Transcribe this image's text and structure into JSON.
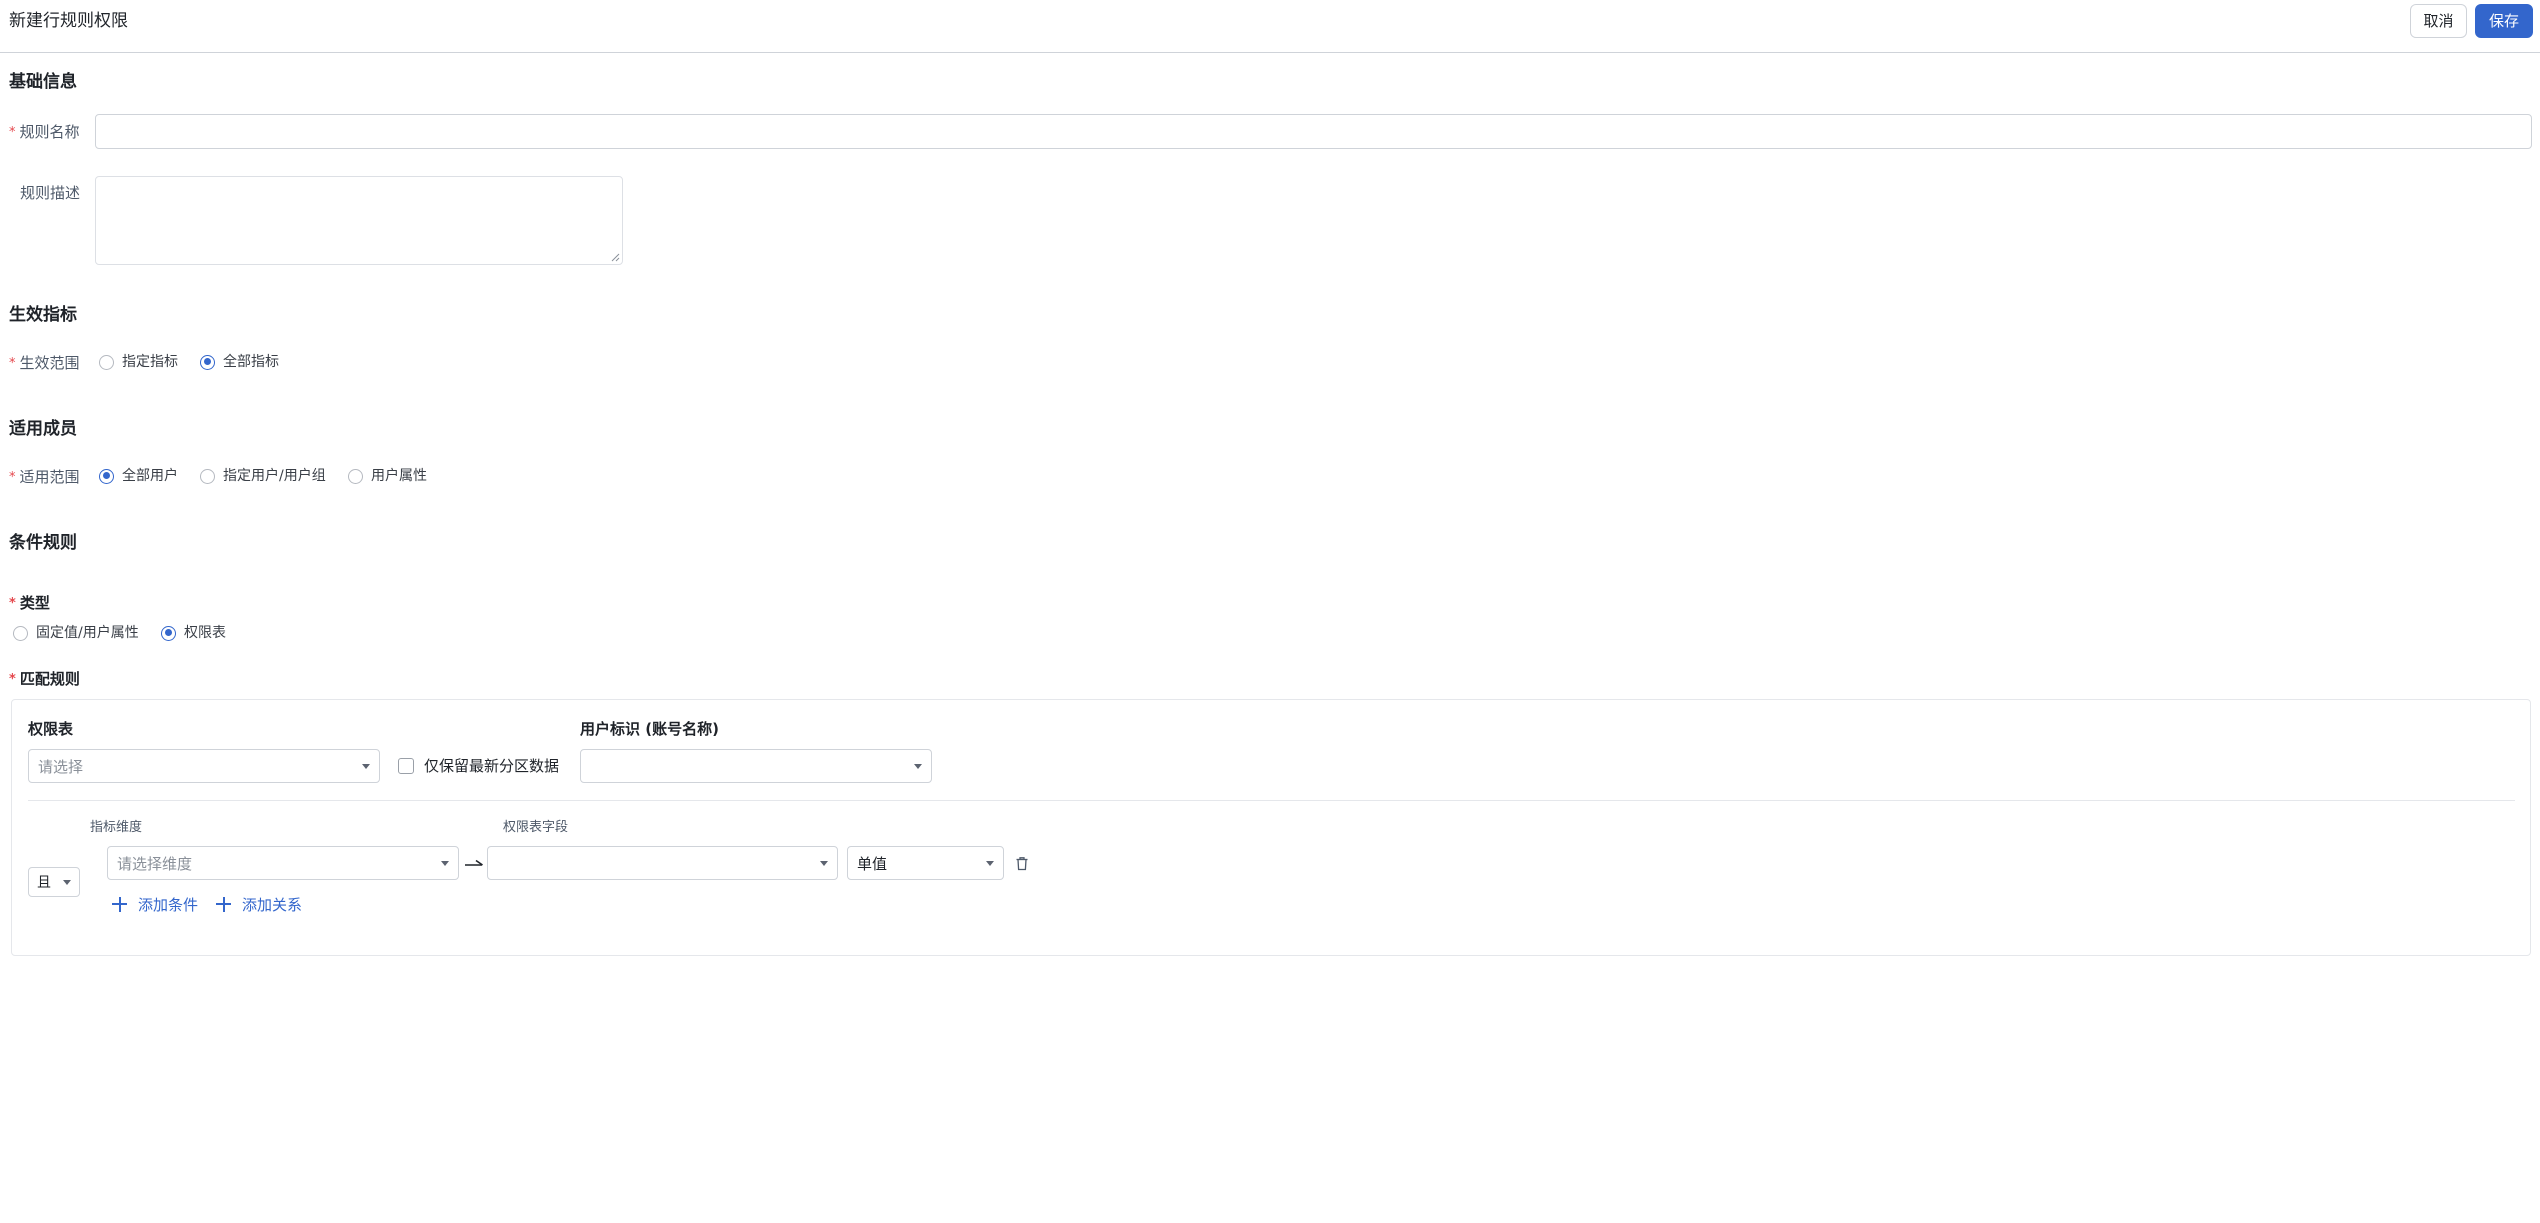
{
  "header": {
    "title": "新建行规则权限",
    "cancel_label": "取消",
    "save_label": "保存"
  },
  "basic_info": {
    "section_title": "基础信息",
    "rule_name_label": "规则名称",
    "rule_name_value": "",
    "rule_desc_label": "规则描述",
    "rule_desc_value": ""
  },
  "effective_metrics": {
    "section_title": "生效指标",
    "scope_label": "生效范围",
    "options": [
      "指定指标",
      "全部指标"
    ],
    "selected": "全部指标"
  },
  "members": {
    "section_title": "适用成员",
    "scope_label": "适用范围",
    "options": [
      "全部用户",
      "指定用户/用户组",
      "用户属性"
    ],
    "selected": "全部用户"
  },
  "condition_rules": {
    "section_title": "条件规则",
    "type_label": "类型",
    "type_options": [
      "固定值/用户属性",
      "权限表"
    ],
    "type_selected": "权限表",
    "match_label": "匹配规则",
    "permission_table_label": "权限表",
    "permission_table_placeholder": "请选择",
    "keep_latest_label": "仅保留最新分区数据",
    "keep_latest_checked": false,
    "user_id_label": "用户标识 (账号名称)",
    "user_id_value": "",
    "logic_value": "且",
    "dimension_header": "指标维度",
    "field_header": "权限表字段",
    "condition": {
      "dimension_placeholder": "请选择维度",
      "field_value": "",
      "value_type": "单值"
    },
    "add_condition_label": "添加条件",
    "add_relation_label": "添加关系"
  },
  "colors": {
    "primary": "#3366cc",
    "required": "#e5484d",
    "border": "#cfd3d9"
  }
}
